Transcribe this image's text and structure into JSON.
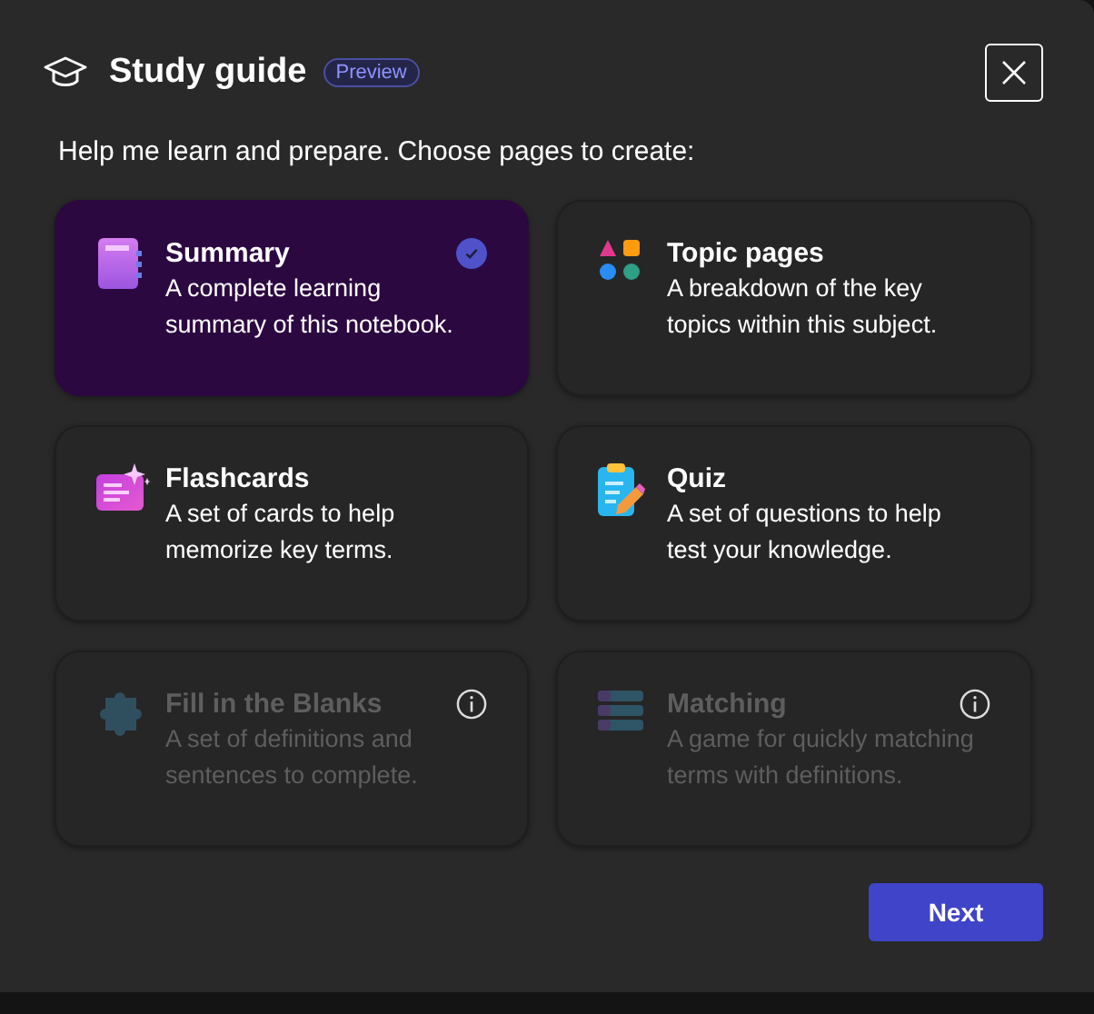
{
  "dialog": {
    "title": "Study guide",
    "badge": "Preview",
    "prompt": "Help me learn and prepare. Choose pages to create:"
  },
  "options": [
    {
      "kind": "summary",
      "title": "Summary",
      "description": "A complete learning summary of this notebook.",
      "selected": true,
      "disabled": false
    },
    {
      "kind": "topics",
      "title": "Topic pages",
      "description": "A breakdown of the key topics within this subject.",
      "selected": false,
      "disabled": false
    },
    {
      "kind": "flashcards",
      "title": "Flashcards",
      "description": "A set of cards to help memorize key terms.",
      "selected": false,
      "disabled": false
    },
    {
      "kind": "quiz",
      "title": "Quiz",
      "description": "A set of questions to help test your knowledge.",
      "selected": false,
      "disabled": false
    },
    {
      "kind": "blanks",
      "title": "Fill in the Blanks",
      "description": "A set of definitions and sentences to complete.",
      "selected": false,
      "disabled": true
    },
    {
      "kind": "matching",
      "title": "Matching",
      "description": "A game for quickly matching terms with definitions.",
      "selected": false,
      "disabled": true
    }
  ],
  "buttons": {
    "primary": "Next"
  }
}
